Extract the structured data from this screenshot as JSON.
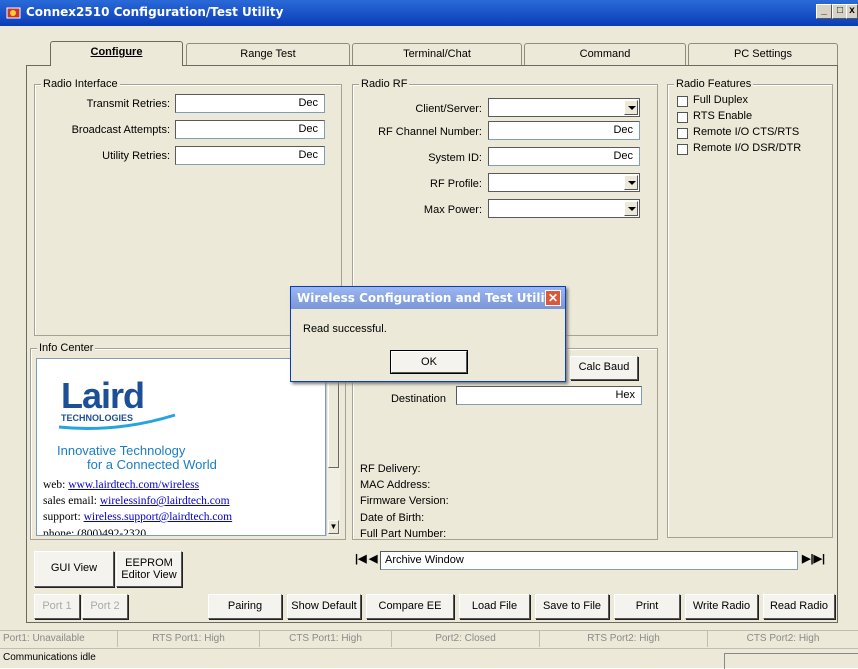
{
  "window": {
    "title": "Connex2510 Configuration/Test Utility"
  },
  "tabs": [
    "Configure",
    "Range Test",
    "Terminal/Chat",
    "Command",
    "PC Settings"
  ],
  "radio_interface": {
    "title": "Radio Interface",
    "rows": [
      {
        "label": "Transmit Retries:",
        "unit": "Dec"
      },
      {
        "label": "Broadcast Attempts:",
        "unit": "Dec"
      },
      {
        "label": "Utility Retries:",
        "unit": "Dec"
      }
    ]
  },
  "radio_rf": {
    "title": "Radio RF",
    "client_server": "Client/Server:",
    "channel": "RF Channel Number:",
    "channel_unit": "Dec",
    "system_id": "System ID:",
    "system_id_unit": "Dec",
    "rf_profile": "RF Profile:",
    "max_power": "Max Power:"
  },
  "radio_features": {
    "title": "Radio Features",
    "items": [
      "Full Duplex",
      "RTS Enable",
      "Remote I/O CTS/RTS",
      "Remote I/O DSR/DTR"
    ]
  },
  "info_center": {
    "title": "Info Center",
    "logo": "Laird",
    "logo_sub": "TECHNOLOGIES",
    "tagline1": "Innovative Technology",
    "tagline2": "for a Connected World",
    "web_label": "web:",
    "web": "www.lairdtech.com/wireless",
    "sales_label": "sales email:",
    "sales": "wirelessinfo@lairdtech.com",
    "support_label": "support:",
    "support": "wireless.support@lairdtech.com",
    "phone_partial": "phone: (800)492-2320"
  },
  "right_panel": {
    "calc_baud": "Calc Baud",
    "destination": "Destination",
    "destination_unit": "Hex",
    "rf_delivery": "RF Delivery:",
    "mac": "MAC Address:",
    "firmware": "Firmware Version:",
    "dob": "Date of Birth:",
    "part": "Full Part Number:"
  },
  "view_buttons": {
    "gui": "GUI View",
    "eeprom1": "EEPROM",
    "eeprom2": "Editor View"
  },
  "archive": {
    "label": "Archive Window"
  },
  "bottom_buttons": [
    "Port 1",
    "Port 2",
    "Pairing",
    "Show Default",
    "Compare EE",
    "Load File",
    "Save to File",
    "Print",
    "Write Radio",
    "Read Radio"
  ],
  "status_bar": [
    "Port1: Unavailable",
    "RTS Port1: High",
    "CTS Port1: High",
    "Port2: Closed",
    "RTS Port2: High",
    "CTS Port2: High"
  ],
  "status_line": "Communications idle",
  "dialog": {
    "title": "Wireless Configuration and Test Utility",
    "message": "Read successful.",
    "ok": "OK"
  },
  "colors": {
    "accent": "#2a6ad8",
    "link": "#0000cc",
    "brand_blue": "#1c4f96"
  }
}
